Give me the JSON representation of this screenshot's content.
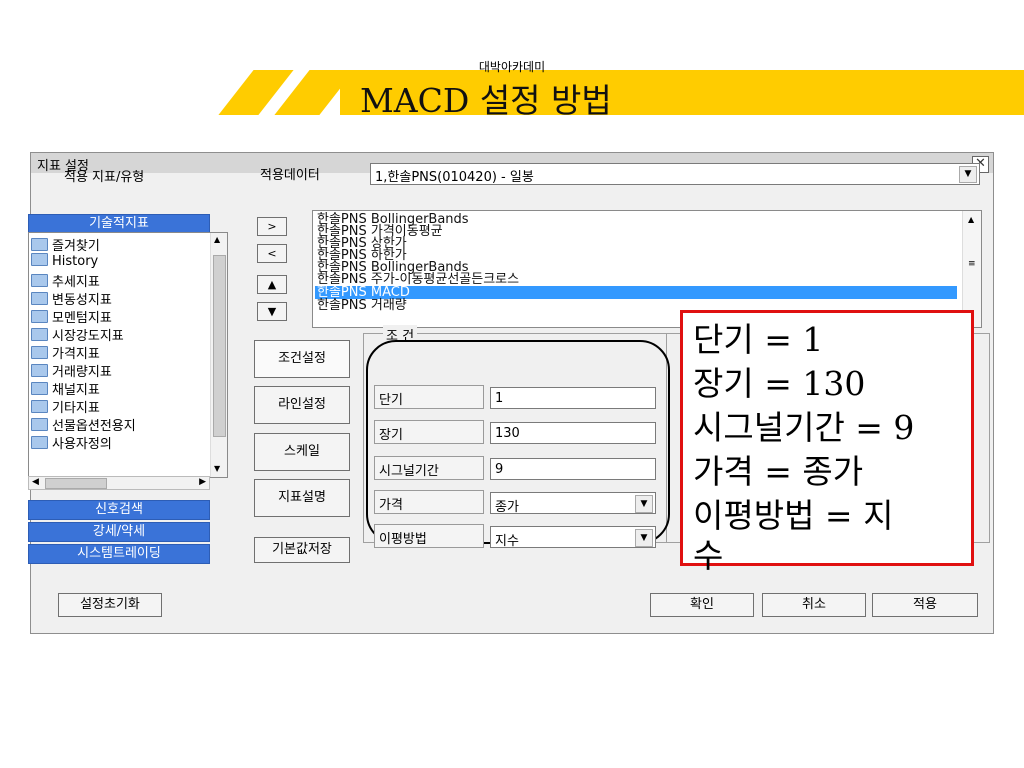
{
  "slide": {
    "subtitle": "대박아카데미",
    "title": "MACD 설정 방법"
  },
  "dialog": {
    "title": "지표 설정",
    "close_icon": "close-icon",
    "left_header": "적용 지표/유형",
    "apply_data_label": "적용데이터",
    "apply_data_value": "1,한솔PNS(010420) - 일봉",
    "categories": {
      "technical": "기술적지표",
      "signal_search": "신호검색",
      "strength": "강세/약세",
      "system_trading": "시스템트레이딩"
    },
    "tree_items": [
      "즐겨찾기",
      "History",
      "추세지표",
      "변동성지표",
      "모멘텀지표",
      "시장강도지표",
      "가격지표",
      "거래량지표",
      "채널지표",
      "기타지표",
      "선물옵션전용지",
      "사용자정의"
    ],
    "move_buttons": {
      "add": ">",
      "remove": "<",
      "up": "▲",
      "down": "▼"
    },
    "applied_indicators": [
      "한솔PNS BollingerBands",
      "한솔PNS 가격이동평균",
      "한솔PNS 상한가",
      "한솔PNS 하한가",
      "한솔PNS BollingerBands",
      "한솔PNS 주가-이동평균선골든크로스",
      "한솔PNS MACD",
      "한솔PNS 거래량"
    ],
    "selected_indicator_index": 6,
    "side_buttons": [
      "조건설정",
      "라인설정",
      "스케일",
      "지표설명",
      "기본값저장"
    ],
    "condition": {
      "legend": "조 건",
      "fields": [
        {
          "label": "단기",
          "value": "1"
        },
        {
          "label": "장기",
          "value": "130"
        },
        {
          "label": "시그널기간",
          "value": "9"
        }
      ],
      "selects": [
        {
          "label": "가격",
          "value": "종가"
        },
        {
          "label": "이평방법",
          "value": "지수"
        }
      ]
    },
    "reset_button": "설정초기화",
    "ok_button": "확인",
    "cancel_button": "취소",
    "apply_button": "적용"
  },
  "annotation": {
    "lines": [
      "단기 = 1",
      "장기 = 130",
      "시그널기간 = 9",
      "가격 = 종가",
      "이평방법 = 지",
      "수"
    ],
    "border_color": "#e01010"
  },
  "colors": {
    "header_yellow": "#ffcc00",
    "category_blue": "#3a73d8",
    "selection_blue": "#3399ff"
  }
}
